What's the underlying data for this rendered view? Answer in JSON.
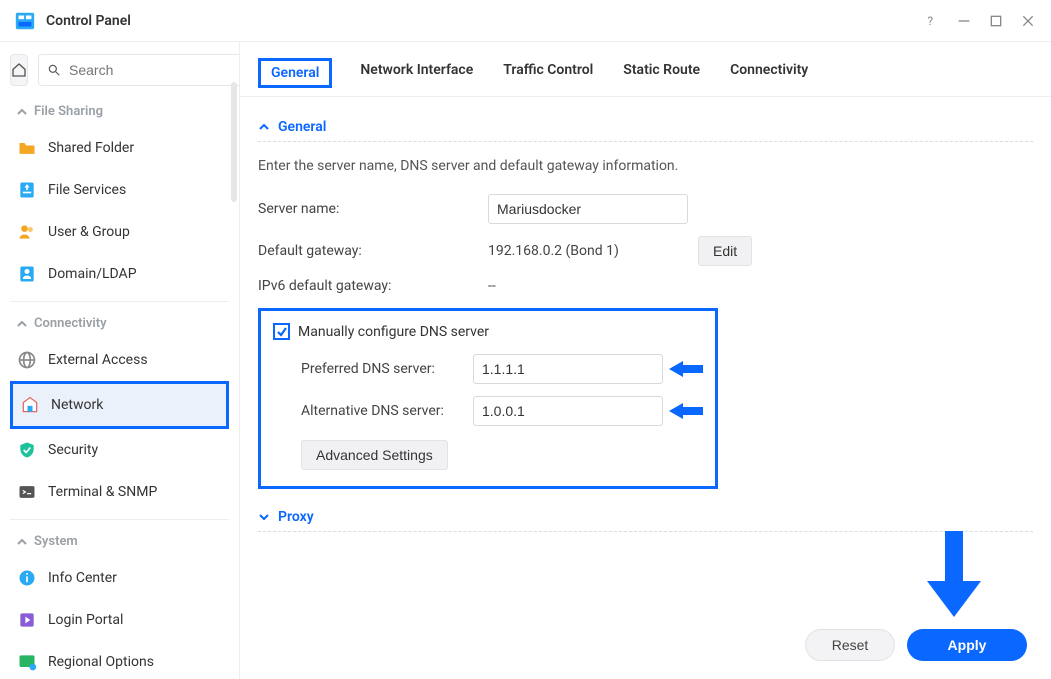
{
  "app_title": "Control Panel",
  "search_placeholder": "Search",
  "sidebar": {
    "sections": {
      "file_sharing": "File Sharing",
      "connectivity": "Connectivity",
      "system": "System"
    },
    "items": {
      "shared_folder": "Shared Folder",
      "file_services": "File Services",
      "user_group": "User & Group",
      "domain_ldap": "Domain/LDAP",
      "external_access": "External Access",
      "network": "Network",
      "security": "Security",
      "terminal_snmp": "Terminal & SNMP",
      "info_center": "Info Center",
      "login_portal": "Login Portal",
      "regional_options": "Regional Options"
    }
  },
  "tabs": {
    "general": "General",
    "network_interface": "Network Interface",
    "traffic_control": "Traffic Control",
    "static_route": "Static Route",
    "connectivity": "Connectivity"
  },
  "general": {
    "section_title": "General",
    "description": "Enter the server name, DNS server and default gateway information.",
    "server_name_label": "Server name:",
    "server_name_value": "Mariusdocker",
    "default_gateway_label": "Default gateway:",
    "default_gateway_value": "192.168.0.2 (Bond 1)",
    "edit_button": "Edit",
    "ipv6_gateway_label": "IPv6 default gateway:",
    "ipv6_gateway_value": "--",
    "manual_dns_label": "Manually configure DNS server",
    "preferred_dns_label": "Preferred DNS server:",
    "preferred_dns_value": "1.1.1.1",
    "alternative_dns_label": "Alternative DNS server:",
    "alternative_dns_value": "1.0.0.1",
    "advanced_settings": "Advanced Settings"
  },
  "proxy_title": "Proxy",
  "footer": {
    "reset": "Reset",
    "apply": "Apply"
  }
}
